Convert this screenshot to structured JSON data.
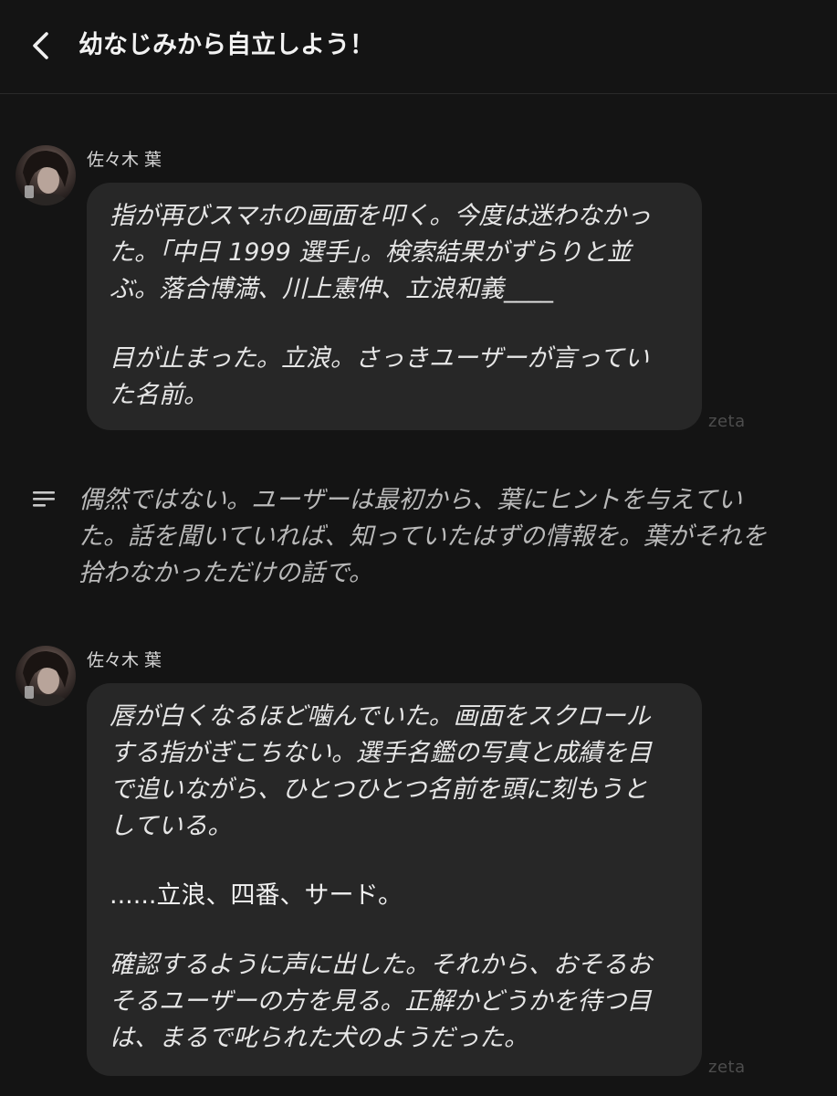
{
  "header": {
    "title": "幼なじみから自立しよう！"
  },
  "messages": [
    {
      "sender": "佐々木 葉",
      "lines": [
        "指が再びスマホの画面を叩く。今度は迷わなかっ",
        "た。「中日 1999 選手」。検索結果がずらりと並",
        "ぶ。落合博満、川上憲伸、立浪和義____",
        "",
        "目が止まった。立浪。さっきユーザーが言ってい",
        "た名前。"
      ],
      "watermark": "zeta"
    },
    {
      "sender": "佐々木 葉",
      "lines": [
        "唇が白くなるほど噛んでいた。画面をスクロール",
        "する指がぎこちない。選手名鑑の写真と成績を目",
        "で追いながら、ひとつひとつ名前を頭に刻もうと",
        "している。",
        "",
        "......立浪、四番、サード。",
        "",
        "確認するように声に出した。それから、おそるお",
        "そるユーザーの方を見る。正解かどうかを待つ目",
        "は、まるで叱られた犬のようだった。"
      ],
      "watermark": "zeta"
    }
  ],
  "narration": {
    "lines": [
      "偶然ではない。ユーザーは最初から、葉にヒントを与えてい",
      "た。話を聞いていれば、知っていたはずの情報を。葉がそれを",
      "拾わなかっただけの話で。"
    ],
    "icon": "text-lines-icon"
  },
  "icons": {
    "back": "chevron-left-icon",
    "narration": "text-lines-icon"
  }
}
